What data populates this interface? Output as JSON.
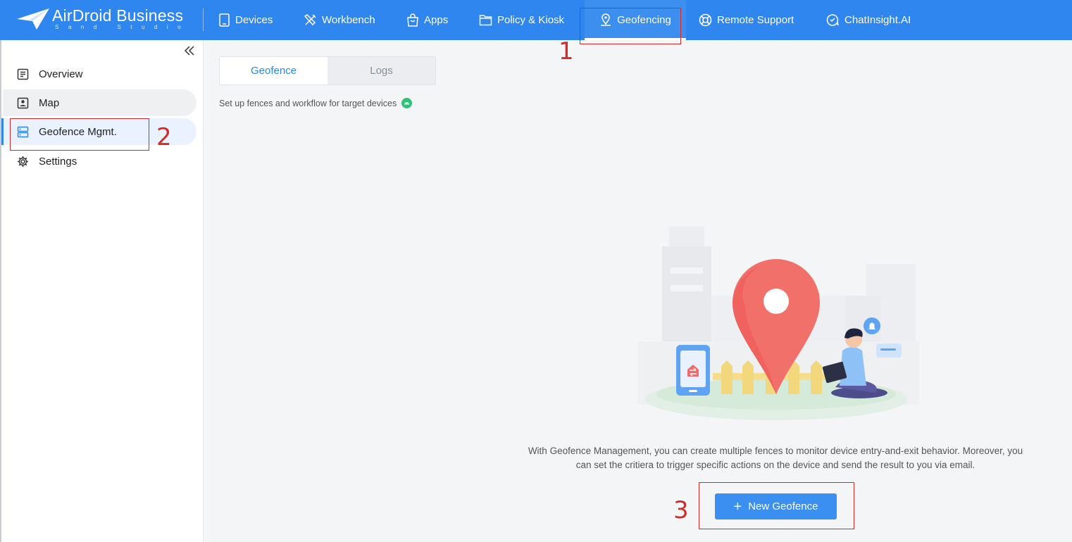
{
  "brand": {
    "name": "AirDroid Business",
    "tagline": "Sand Studio"
  },
  "nav": {
    "items": [
      {
        "label": "Devices",
        "icon": "tablet-icon"
      },
      {
        "label": "Workbench",
        "icon": "tools-icon"
      },
      {
        "label": "Apps",
        "icon": "bag-icon"
      },
      {
        "label": "Policy & Kiosk",
        "icon": "folder-icon"
      },
      {
        "label": "Geofencing",
        "icon": "map-pin-icon",
        "active": true
      },
      {
        "label": "Remote Support",
        "icon": "lifebuoy-icon"
      },
      {
        "label": "ChatInsight.AI",
        "icon": "chat-ai-icon"
      }
    ]
  },
  "sidebar": {
    "items": [
      {
        "label": "Overview",
        "icon": "document-icon"
      },
      {
        "label": "Map",
        "icon": "map-badge-icon"
      },
      {
        "label": "Geofence Mgmt.",
        "icon": "server-icon",
        "active": true
      },
      {
        "label": "Settings",
        "icon": "gear-icon"
      }
    ]
  },
  "main": {
    "tabs": [
      {
        "label": "Geofence",
        "active": true
      },
      {
        "label": "Logs"
      }
    ],
    "subtitle": "Set up fences and workflow for target devices",
    "empty_state": {
      "line1": "With Geofence Management, you can create multiple fences to monitor device entry-and-exit behavior. Moreover, you",
      "line2": "can set the critiera to trigger specific actions on the device and send the result to you via email."
    },
    "new_button": {
      "label": "New Geofence"
    }
  },
  "annotations": [
    "1",
    "2",
    "3"
  ],
  "colors": {
    "accent": "#2f86ee",
    "annotation": "#d52a2a",
    "pin": "#f2706a"
  }
}
